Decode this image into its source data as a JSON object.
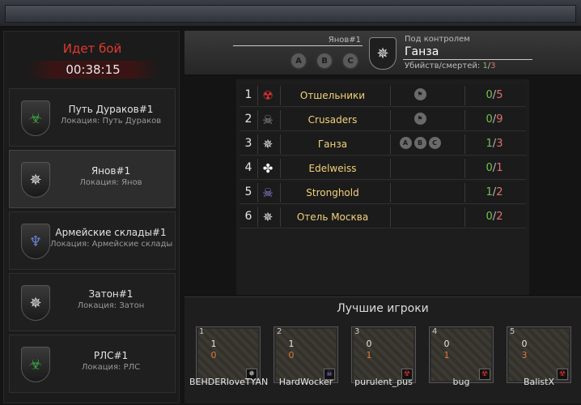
{
  "battle": {
    "title": "Идет бой",
    "time": "00:38:15"
  },
  "locations": [
    {
      "name": "Путь Дураков#1",
      "sub": "Локация: Путь Дураков",
      "icon": "tentacle-emblem-icon",
      "glyph": "☣",
      "color": "#3aa040",
      "active": false
    },
    {
      "name": "Янов#1",
      "sub": "Локация: Янов",
      "icon": "compass-star-emblem-icon",
      "glyph": "✵",
      "color": "#e6e6e6",
      "active": true
    },
    {
      "name": "Армейские склады#1",
      "sub": "Локация: Армейские склады",
      "icon": "wings-emblem-icon",
      "glyph": "♆",
      "color": "#6a7fd0",
      "active": false
    },
    {
      "name": "Затон#1",
      "sub": "Локация: Затон",
      "icon": "compass-star-emblem-icon",
      "glyph": "✵",
      "color": "#e6e6e6",
      "active": false
    },
    {
      "name": "РЛС#1",
      "sub": "Локация: РЛС",
      "icon": "tentacle-emblem-icon",
      "glyph": "☣",
      "color": "#3aa040",
      "active": false
    }
  ],
  "header": {
    "location": "Янов#1",
    "points": [
      "A",
      "B",
      "C"
    ],
    "control_label": "Под контролем",
    "control_value": "Ганза",
    "kd_label": "Убийств/смертей:",
    "kills": "1",
    "deaths": "3"
  },
  "clans": [
    {
      "rank": "1",
      "name": "Отшельники",
      "icon": "radiation-icon",
      "glyph": "☢",
      "color": "#e03030",
      "badges": [
        "flag"
      ],
      "kills": "0",
      "deaths": "5"
    },
    {
      "rank": "2",
      "name": "Crusaders",
      "icon": "skull-icon",
      "glyph": "☠",
      "color": "#9a9a9a",
      "badges": [
        "flag"
      ],
      "kills": "0",
      "deaths": "9"
    },
    {
      "rank": "3",
      "name": "Ганза",
      "icon": "compass-star-icon",
      "glyph": "✵",
      "color": "#e6e6e6",
      "badges": [
        "A",
        "B",
        "C"
      ],
      "kills": "1",
      "deaths": "3"
    },
    {
      "rank": "4",
      "name": "Edelweiss",
      "icon": "clover-icon",
      "glyph": "✤",
      "color": "#ffffff",
      "badges": [],
      "kills": "0",
      "deaths": "1"
    },
    {
      "rank": "5",
      "name": "Stronghold",
      "icon": "purple-skull-icon",
      "glyph": "☠",
      "color": "#9a8ae8",
      "badges": [],
      "kills": "1",
      "deaths": "2"
    },
    {
      "rank": "6",
      "name": "Отель Москва",
      "icon": "compass-star-icon",
      "glyph": "✵",
      "color": "#e6e6e6",
      "badges": [],
      "kills": "0",
      "deaths": "2"
    }
  ],
  "best": {
    "title": "Лучшие игроки",
    "players": [
      {
        "rank": "1",
        "name": "BEHDERloveTYAN",
        "kills": "1",
        "deaths": "0",
        "icon": "compass-star-icon",
        "glyph": "✵",
        "color": "#e6e6e6"
      },
      {
        "rank": "2",
        "name": "HardWocker",
        "kills": "1",
        "deaths": "0",
        "icon": "purple-skull-icon",
        "glyph": "☠",
        "color": "#9a8ae8"
      },
      {
        "rank": "3",
        "name": "purulent_pus",
        "kills": "0",
        "deaths": "1",
        "icon": "radiation-icon",
        "glyph": "☢",
        "color": "#e03030"
      },
      {
        "rank": "4",
        "name": "bug",
        "kills": "0",
        "deaths": "1",
        "icon": "radiation-icon",
        "glyph": "☢",
        "color": "#e03030"
      },
      {
        "rank": "5",
        "name": "BalistX",
        "kills": "0",
        "deaths": "3",
        "icon": "radiation-icon",
        "glyph": "☢",
        "color": "#e03030"
      }
    ]
  }
}
